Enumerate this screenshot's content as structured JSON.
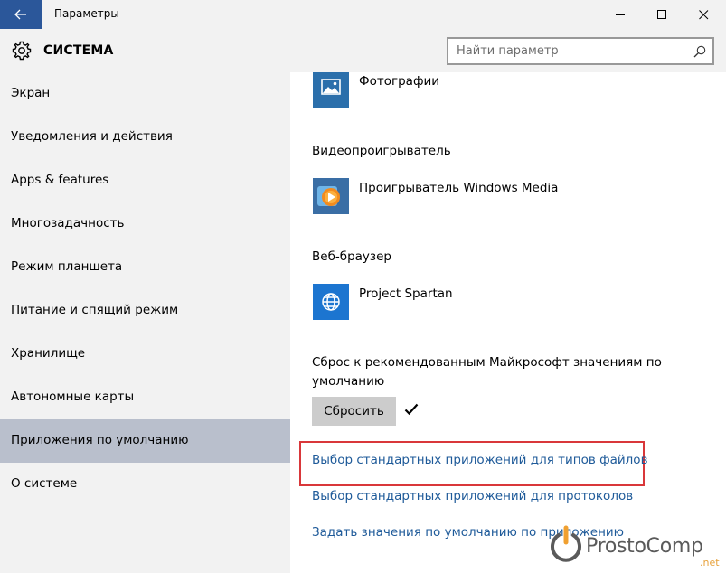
{
  "window": {
    "title": "Параметры"
  },
  "header": {
    "section_title": "СИСТЕМА",
    "search_placeholder": "Найти параметр"
  },
  "sidebar": {
    "items": [
      {
        "label": "Экран"
      },
      {
        "label": "Уведомления и действия"
      },
      {
        "label": "Apps & features"
      },
      {
        "label": "Многозадачность"
      },
      {
        "label": "Режим планшета"
      },
      {
        "label": "Питание и спящий режим"
      },
      {
        "label": "Хранилище"
      },
      {
        "label": "Автономные карты"
      },
      {
        "label": "Приложения по умолчанию",
        "selected": true
      },
      {
        "label": "О системе"
      }
    ]
  },
  "content": {
    "photos_app": "Фотографии",
    "video_label": "Видеопроигрыватель",
    "video_app": "Проигрыватель Windows Media",
    "browser_label": "Веб-браузер",
    "browser_app": "Project Spartan",
    "reset_description": "Сброс к рекомендованным Майкрософт значениям по умолчанию",
    "reset_button": "Сбросить",
    "links": [
      "Выбор стандартных приложений для типов файлов",
      "Выбор стандартных приложений для протоколов",
      "Задать значения по умолчанию по приложению"
    ]
  },
  "watermark": {
    "text": "ProstoComp",
    "suffix": ".net"
  },
  "colors": {
    "accent": "#2b579a",
    "sidebar_bg": "#f2f2f2",
    "selected_bg": "#b9bfcc",
    "link": "#1e5a99",
    "highlight_border": "#d9373a",
    "button_bg": "#cccccc"
  }
}
